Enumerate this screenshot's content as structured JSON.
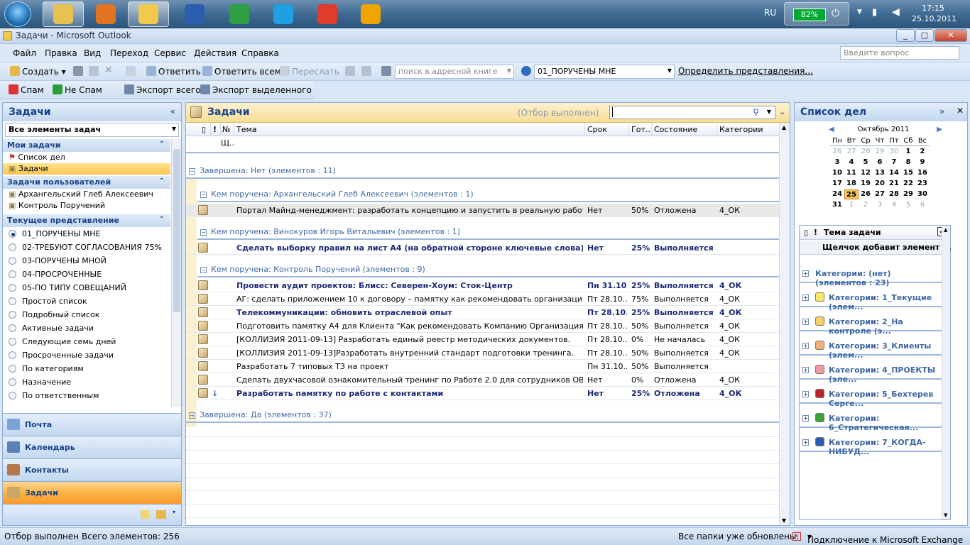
{
  "taskbar": {
    "apps": [
      {
        "icon": "explorer-icon",
        "color": "#e8c155"
      },
      {
        "icon": "media-player-icon",
        "color": "#e07420"
      },
      {
        "icon": "outlook-icon",
        "color": "#f2c94c"
      },
      {
        "icon": "word-icon",
        "color": "#2b5fae"
      },
      {
        "icon": "chrome-icon",
        "color": "#2ea043"
      },
      {
        "icon": "skype-icon",
        "color": "#1ea1e3"
      },
      {
        "icon": "mail-ru-agent-icon",
        "color": "#e03b2c"
      },
      {
        "icon": "winamp-icon",
        "color": "#f0a400"
      }
    ],
    "lang": "RU",
    "battery": "82%",
    "time": "17:15",
    "date": "25.10.2011"
  },
  "window": {
    "title": "Задачи - Microsoft Outlook",
    "minimize": "_",
    "maximize": "□",
    "close": "✕"
  },
  "menu": {
    "items": [
      "Файл",
      "Правка",
      "Вид",
      "Переход",
      "Сервис",
      "Действия",
      "Справка"
    ],
    "ask_placeholder": "Введите вопрос"
  },
  "toolbar1": {
    "create": "Создать",
    "reply": "Ответить",
    "reply_all": "Ответить всем",
    "forward": "Переслать",
    "address_search": "поиск в адресной книге",
    "view_select": "01_ПОРУЧЕНЫ МНЕ",
    "define_views": "Определить представления..."
  },
  "toolbar2": {
    "spam": "Спам",
    "not_spam": "Не Спам",
    "export_all": "Экспорт всего",
    "export_selected": "Экспорт выделенного"
  },
  "left": {
    "title": "Задачи",
    "collapse": "«",
    "folder_select": "Все элементы задач",
    "my_tasks_header": "Мои задачи",
    "my_tasks": [
      "Список дел",
      "Задачи"
    ],
    "user_tasks_header": "Задачи пользователей",
    "user_tasks": [
      "Архангельский Глеб Алексеевич",
      "Контроль Поручений"
    ],
    "current_view_header": "Текущее представление",
    "views": [
      "01_ПОРУЧЕНЫ МНЕ",
      "02-ТРЕБУЮТ СОГЛАСОВАНИЯ 75%",
      "03-ПОРУЧЕНЫ МНОЙ",
      "04-ПРОСРОЧЕННЫЕ",
      "05-ПО ТИПУ СОВЕЩАНИЙ",
      "Простой список",
      "Подробный список",
      "Активные задачи",
      "Следующие семь дней",
      "Просроченные задачи",
      "По категориям",
      "Назначение",
      "По ответственным"
    ],
    "nav": [
      "Почта",
      "Календарь",
      "Контакты",
      "Задачи"
    ]
  },
  "center": {
    "title": "Задачи",
    "filter_status": "(Отбор выполнен)",
    "columns": {
      "num": "№",
      "subject": "Тема",
      "due": "Срок",
      "done": "Гот...",
      "status": "Состояние",
      "categories": "Категории"
    },
    "new_row_hint": "Щ..",
    "groups": {
      "completed_no": "Завершена: Нет (элементов : 11)",
      "by_arkh": "Кем поручена: Архангельский Глеб Алексеевич (элементов : 1)",
      "by_vinok": "Кем поручена: Винокуров Игорь Витальевич (элементов : 1)",
      "by_control": "Кем поручена: Контроль Поручений (элементов : 9)",
      "completed_yes": "Завершена: Да (элементов : 37)"
    },
    "rows_arkh": [
      {
        "subject": "Портал Майнд-менеджмент: разработать концепцию и запустить в реальную работу",
        "due": "Нет",
        "pct": "50%",
        "status": "Отложена",
        "cat": "4_ОК",
        "bold": false
      }
    ],
    "rows_vinok": [
      {
        "subject": "Сделать выборку правил на лист А4 (на обратной стороне ключевые слова): Стандарт ...",
        "due": "Нет",
        "pct": "25%",
        "status": "Выполняется",
        "cat": "",
        "bold": true
      }
    ],
    "rows_control": [
      {
        "subject": "Провести аудит проектов: Блисс: Северен-Хоум: Сток-Центр",
        "due": "Пн 31.10....",
        "pct": "25%",
        "status": "Выполняется",
        "cat": "4_ОК",
        "bold": true
      },
      {
        "subject": "АГ: сделать приложением 10 к договору – памятку как рекомендовать организацию вре...",
        "due": "Пт 28.10....",
        "pct": "75%",
        "status": "Выполняется",
        "cat": "4_ОК",
        "bold": false
      },
      {
        "subject": "Телекоммуникации: обновить отраслевой опыт",
        "due": "Пт 28.10....",
        "pct": "25%",
        "status": "Выполняется",
        "cat": "4_ОК",
        "bold": true
      },
      {
        "subject": "Подготовить памятку А4 для Клиента \"Как рекомендовать Компанию Организация Врем...",
        "due": "Пт 28.10....",
        "pct": "50%",
        "status": "Выполняется",
        "cat": "4_ОК",
        "bold": false
      },
      {
        "subject": "[КОЛЛИЗИЯ 2011-09-13] Разработать единый реестр методических документов.",
        "due": "Пт 28.10....",
        "pct": "0%",
        "status": "Не началась",
        "cat": "4_ОК",
        "bold": false
      },
      {
        "subject": "[КОЛЛИЗИЯ 2011-09-13]Разработать внутренний стандарт подготовки тренинга.",
        "due": "Пт 28.10....",
        "pct": "50%",
        "status": "Выполняется",
        "cat": "4_ОК",
        "bold": false
      },
      {
        "subject": "Разработать 7 типовых ТЗ на проект",
        "due": "Пн 31.10....",
        "pct": "50%",
        "status": "Выполняется",
        "cat": "",
        "bold": false
      },
      {
        "subject": "Сделать двухчасовой ознакомительный тренинг по Работе 2.0 для сотрудников ОВ",
        "due": "Нет",
        "pct": "0%",
        "status": "Отложена",
        "cat": "4_ОК",
        "bold": false
      },
      {
        "subject": "Разработать памятку по работе с контактами",
        "due": "Нет",
        "pct": "25%",
        "status": "Отложена",
        "cat": "4_ОК",
        "bold": true
      }
    ]
  },
  "right": {
    "title": "Список дел",
    "month": "Октябрь 2011",
    "weekdays": [
      "Пн",
      "Вт",
      "Ср",
      "Чт",
      "Пт",
      "Сб",
      "Вс"
    ],
    "weeks": [
      [
        "26",
        "27",
        "28",
        "29",
        "30",
        "1",
        "2"
      ],
      [
        "3",
        "4",
        "5",
        "6",
        "7",
        "8",
        "9"
      ],
      [
        "10",
        "11",
        "12",
        "13",
        "14",
        "15",
        "16"
      ],
      [
        "17",
        "18",
        "19",
        "20",
        "21",
        "22",
        "23"
      ],
      [
        "24",
        "25",
        "26",
        "27",
        "28",
        "29",
        "30"
      ],
      [
        "31",
        "1",
        "2",
        "3",
        "4",
        "5",
        "6"
      ]
    ],
    "todo_header": "Тема задачи",
    "add_hint": "Щелчок добавит элемент ...",
    "categories": [
      {
        "label": "Категории: (нет) (элементов : 23)",
        "color": ""
      },
      {
        "label": "Категории: 1_Текущие (элем...",
        "color": "#ffe766"
      },
      {
        "label": "Категории: 2_На контроле (э...",
        "color": "#f9d267"
      },
      {
        "label": "Категории: 3_Клиенты (элем...",
        "color": "#f6b07a"
      },
      {
        "label": "Категории: 4_ПРОЕКТЫ (эле...",
        "color": "#f29aa6"
      },
      {
        "label": "Категории: 5_Бехтерев Серге...",
        "color": "#c0212b"
      },
      {
        "label": "Категории: 6_Стратегическая...",
        "color": "#3aa03a"
      },
      {
        "label": "Категории: 7_КОГДА-НИБУД...",
        "color": "#2d5bb3"
      }
    ]
  },
  "status": {
    "filter": "Отбор выполнен",
    "total": "Всего элементов: 256",
    "folders": "Все папки уже обновлены.",
    "connection": "Подключение к Microsoft Exchange"
  }
}
